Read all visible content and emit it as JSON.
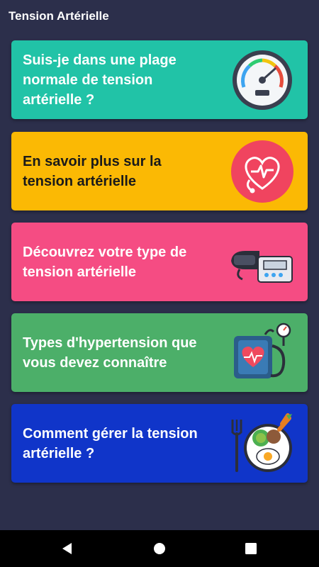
{
  "app": {
    "title": "Tension Artérielle"
  },
  "cards": [
    {
      "label": "Suis-je dans une plage normale de tension artérielle ?",
      "color": "#21c3a7",
      "text_color": "#ffffff",
      "icon": "gauge-icon"
    },
    {
      "label": "En savoir plus sur la tension artérielle",
      "color": "#fbb904",
      "text_color": "#1a1a1a",
      "icon": "heart-stethoscope-icon"
    },
    {
      "label": "Découvrez votre type de tension artérielle",
      "color": "#f54c83",
      "text_color": "#ffffff",
      "icon": "blood-pressure-monitor-icon"
    },
    {
      "label": "Types d'hypertension que vous devez connaître",
      "color": "#4caf69",
      "text_color": "#ffffff",
      "icon": "sphygmomanometer-icon"
    },
    {
      "label": "Comment gérer la tension artérielle ?",
      "color": "#1035c9",
      "text_color": "#ffffff",
      "icon": "healthy-food-icon"
    }
  ],
  "navbar": {
    "back": "back-icon",
    "home": "home-icon",
    "recents": "recents-icon"
  }
}
